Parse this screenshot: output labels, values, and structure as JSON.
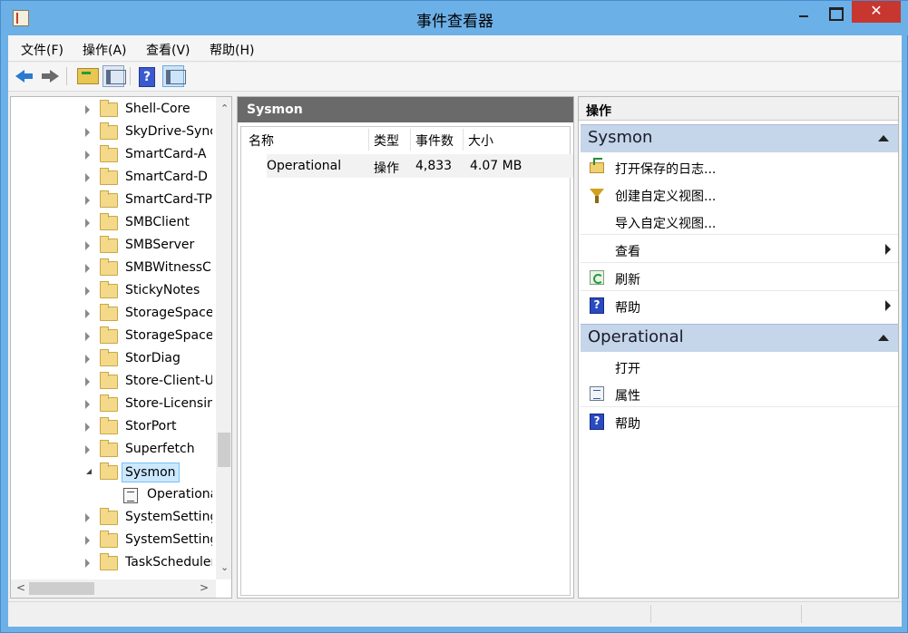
{
  "window": {
    "title": "事件查看器",
    "close_glyph": "✕"
  },
  "menu": {
    "items": [
      "文件(F)",
      "操作(A)",
      "查看(V)",
      "帮助(H)"
    ]
  },
  "toolbar": {
    "help_glyph": "?"
  },
  "tree": {
    "items": [
      {
        "label": "Shell-Core"
      },
      {
        "label": "SkyDrive-Sync"
      },
      {
        "label": "SmartCard-A"
      },
      {
        "label": "SmartCard-D"
      },
      {
        "label": "SmartCard-TPM"
      },
      {
        "label": "SMBClient"
      },
      {
        "label": "SMBServer"
      },
      {
        "label": "SMBWitnessClient"
      },
      {
        "label": "StickyNotes"
      },
      {
        "label": "StorageSpaces"
      },
      {
        "label": "StorageSpaces"
      },
      {
        "label": "StorDiag"
      },
      {
        "label": "Store-Client-UI"
      },
      {
        "label": "Store-Licensing"
      },
      {
        "label": "StorPort"
      },
      {
        "label": "Superfetch"
      },
      {
        "label": "Sysmon",
        "expanded": true,
        "selected": true
      },
      {
        "label": "Operational",
        "child": true
      },
      {
        "label": "SystemSettings"
      },
      {
        "label": "SystemSettings"
      },
      {
        "label": "TaskScheduler"
      }
    ],
    "scroll_up": "⌃",
    "scroll_down": "⌄",
    "scroll_left": "<",
    "scroll_right": ">"
  },
  "middle": {
    "header": "Sysmon",
    "columns": [
      "名称",
      "类型",
      "事件数",
      "大小"
    ],
    "rows": [
      {
        "name": "Operational",
        "type": "操作",
        "count": "4,833",
        "size": "4.07 MB"
      }
    ]
  },
  "actions": {
    "title": "操作",
    "sections": [
      {
        "name": "Sysmon",
        "items": [
          {
            "label": "打开保存的日志...",
            "icon": "open-log-icon"
          },
          {
            "label": "创建自定义视图...",
            "icon": "filter-icon"
          },
          {
            "label": "导入自定义视图...",
            "icon": ""
          },
          {
            "label": "查看",
            "submenu": true
          },
          {
            "label": "刷新",
            "icon": "refresh-icon"
          },
          {
            "label": "帮助",
            "icon": "help-icon",
            "submenu": true
          }
        ]
      },
      {
        "name": "Operational",
        "items": [
          {
            "label": "打开",
            "icon": ""
          },
          {
            "label": "属性",
            "icon": "properties-icon"
          },
          {
            "label": "帮助",
            "icon": "help-icon"
          }
        ]
      }
    ]
  }
}
